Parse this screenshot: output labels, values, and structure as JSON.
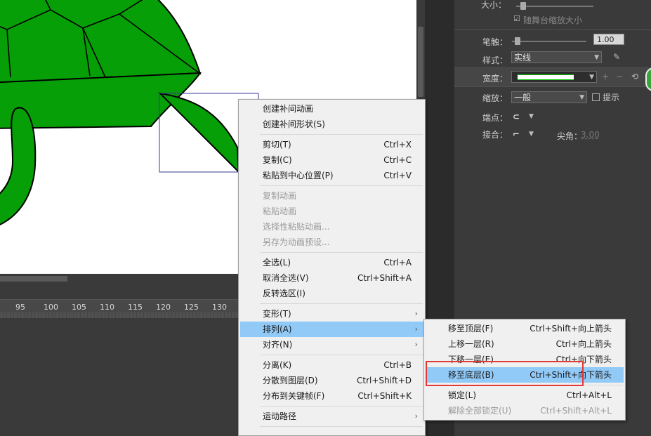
{
  "timeline": {
    "ruler_ticks": [
      "95",
      "100",
      "105",
      "110",
      "115",
      "120",
      "125",
      "130"
    ]
  },
  "properties": {
    "size_label": "大小：",
    "scale_checkbox_label": "随舞台缩放大小",
    "stroke_label": "笔触：",
    "stroke_value": "1.00",
    "style_label": "样式：",
    "style_value": "实线",
    "width_label": "宽度：",
    "scale_label": "缩放：",
    "scale_value": "一般",
    "hint_label": "提示",
    "cap_label": "端点：",
    "join_label": "接合：",
    "miter_label": "尖角：",
    "miter_value": "3.00"
  },
  "context_menu": {
    "items": [
      {
        "label": "创建补间动画",
        "shortcut": "",
        "disabled": false
      },
      {
        "label": "创建补间形状(S)",
        "shortcut": "",
        "disabled": false
      },
      {
        "label": "剪切(T)",
        "shortcut": "Ctrl+X",
        "disabled": false
      },
      {
        "label": "复制(C)",
        "shortcut": "Ctrl+C",
        "disabled": false
      },
      {
        "label": "粘贴到中心位置(P)",
        "shortcut": "Ctrl+V",
        "disabled": false
      },
      {
        "label": "复制动画",
        "shortcut": "",
        "disabled": true
      },
      {
        "label": "粘贴动画",
        "shortcut": "",
        "disabled": true
      },
      {
        "label": "选择性粘贴动画...",
        "shortcut": "",
        "disabled": true
      },
      {
        "label": "另存为动画预设...",
        "shortcut": "",
        "disabled": true
      },
      {
        "label": "全选(L)",
        "shortcut": "Ctrl+A",
        "disabled": false
      },
      {
        "label": "取消全选(V)",
        "shortcut": "Ctrl+Shift+A",
        "disabled": false
      },
      {
        "label": "反转选区(I)",
        "shortcut": "",
        "disabled": false
      },
      {
        "label": "变形(T)",
        "shortcut": "",
        "disabled": false
      },
      {
        "label": "排列(A)",
        "shortcut": "",
        "disabled": false
      },
      {
        "label": "对齐(N)",
        "shortcut": "",
        "disabled": false
      },
      {
        "label": "分离(K)",
        "shortcut": "Ctrl+B",
        "disabled": false
      },
      {
        "label": "分散到图层(D)",
        "shortcut": "Ctrl+Shift+D",
        "disabled": false
      },
      {
        "label": "分布到关键帧(F)",
        "shortcut": "Ctrl+Shift+K",
        "disabled": false
      },
      {
        "label": "运动路径",
        "shortcut": "",
        "disabled": false
      },
      {
        "label": "",
        "shortcut": "",
        "disabled": true
      }
    ]
  },
  "arrange_submenu": {
    "items": [
      {
        "label": "移至顶层(F)",
        "shortcut": "Ctrl+Shift+向上箭头",
        "disabled": false
      },
      {
        "label": "上移一层(R)",
        "shortcut": "Ctrl+向上箭头",
        "disabled": false
      },
      {
        "label": "下移一层(E)",
        "shortcut": "Ctrl+向下箭头",
        "disabled": false
      },
      {
        "label": "移至底层(B)",
        "shortcut": "Ctrl+Shift+向下箭头",
        "disabled": false
      },
      {
        "label": "锁定(L)",
        "shortcut": "Ctrl+Alt+L",
        "disabled": false
      },
      {
        "label": "解除全部锁定(U)",
        "shortcut": "Ctrl+Shift+Alt+L",
        "disabled": true
      }
    ]
  },
  "colors": {
    "turtle_fill": "#079f07",
    "menu_highlight": "#91c9f7",
    "annotation_box": "#e53935"
  }
}
